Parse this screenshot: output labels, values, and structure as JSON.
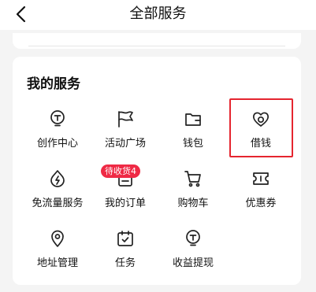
{
  "header": {
    "title": "全部服务",
    "back_icon": "chevron-left-icon"
  },
  "services": {
    "title": "我的服务",
    "items": [
      {
        "label": "创作中心",
        "icon": "lightbulb-icon"
      },
      {
        "label": "活动广场",
        "icon": "flag-icon"
      },
      {
        "label": "钱包",
        "icon": "wallet-icon"
      },
      {
        "label": "借钱",
        "icon": "loan-icon"
      },
      {
        "label": "免流量服务",
        "icon": "data-saver-icon"
      },
      {
        "label": "我的订单",
        "icon": "order-icon",
        "badge": "待收货4"
      },
      {
        "label": "购物车",
        "icon": "cart-icon"
      },
      {
        "label": "优惠券",
        "icon": "coupon-icon"
      },
      {
        "label": "地址管理",
        "icon": "location-pin-icon"
      },
      {
        "label": "任务",
        "icon": "task-calendar-icon"
      },
      {
        "label": "收益提现",
        "icon": "coin-icon"
      }
    ]
  },
  "colors": {
    "badge": "#ef2a45",
    "highlight": "#e5252f"
  }
}
